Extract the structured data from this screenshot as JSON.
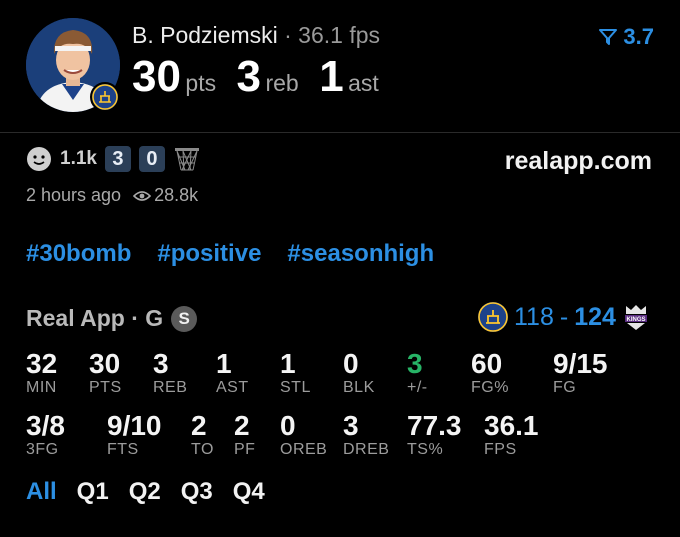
{
  "player": {
    "name": "B. Podziemski",
    "separator": "·",
    "fps_label": "36.1 fps",
    "avatar_icon": "player-headshot",
    "team_badge_icon": "warriors-logo"
  },
  "big_stats": [
    {
      "value": "30",
      "label": "pts"
    },
    {
      "value": "3",
      "label": "reb"
    },
    {
      "value": "1",
      "label": "ast"
    }
  ],
  "version": {
    "icon": "filter-funnel-icon",
    "value": "3.7"
  },
  "reactions": {
    "face_icon": "smiley-face-icon",
    "count": "1.1k",
    "box_a": "3",
    "box_b": "0",
    "hoop_icon": "basketball-net-icon"
  },
  "site": "realapp.com",
  "meta": {
    "time_ago": "2 hours ago",
    "views_icon": "eye-icon",
    "views": "28.8k"
  },
  "tags": [
    "#30bomb",
    "#positive",
    "#seasonhigh"
  ],
  "game": {
    "source": "Real App · G",
    "badge": "S",
    "home_score": "118",
    "dash": "-",
    "away_score": "124",
    "home_logo": "warriors-logo",
    "away_logo": "kings-logo",
    "away_logo_text": "KINGS"
  },
  "stats_row1": [
    {
      "value": "32",
      "key": "MIN"
    },
    {
      "value": "30",
      "key": "PTS"
    },
    {
      "value": "3",
      "key": "REB"
    },
    {
      "value": "1",
      "key": "AST"
    },
    {
      "value": "1",
      "key": "STL"
    },
    {
      "value": "0",
      "key": "BLK"
    },
    {
      "value": "3",
      "key": "+/-"
    },
    {
      "value": "60",
      "key": "FG%"
    },
    {
      "value": "9/15",
      "key": "FG"
    }
  ],
  "stats_row2": [
    {
      "value": "3/8",
      "key": "3FG"
    },
    {
      "value": "9/10",
      "key": "FTS"
    },
    {
      "value": "2",
      "key": "TO"
    },
    {
      "value": "2",
      "key": "PF"
    },
    {
      "value": "0",
      "key": "OREB"
    },
    {
      "value": "3",
      "key": "DREB"
    },
    {
      "value": "77.3",
      "key": "TS%"
    },
    {
      "value": "36.1",
      "key": "FPS"
    }
  ],
  "quarters": [
    "All",
    "Q1",
    "Q2",
    "Q3",
    "Q4"
  ],
  "colors": {
    "accent": "#2c8fe3",
    "positive": "#27b366",
    "background": "#000000"
  }
}
